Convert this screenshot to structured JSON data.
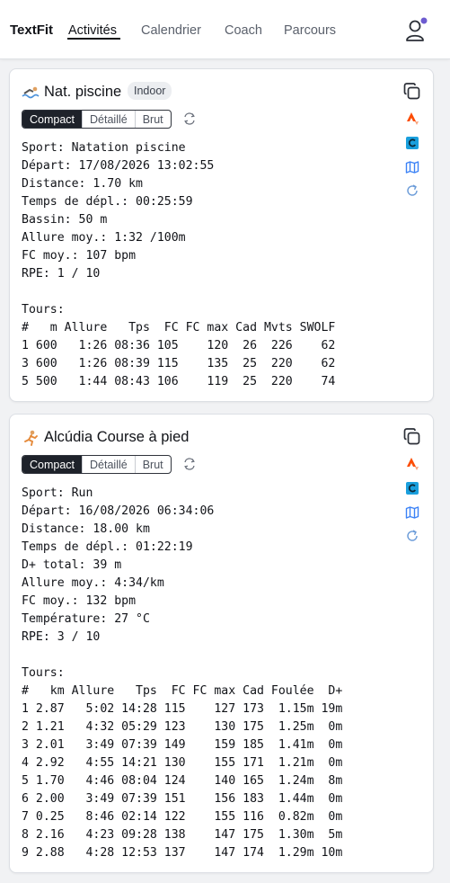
{
  "app": {
    "brand": "TextFit",
    "nav": [
      "Activités",
      "Calendrier",
      "Coach",
      "Parcours"
    ],
    "active_nav": "Activités"
  },
  "colors": {
    "strava": "#fc4c02",
    "garmin": "#1a9fdd",
    "accent_blue": "#3b82f6",
    "notification_dot": "#6d5bd0"
  },
  "view_modes": [
    "Compact",
    "Détaillé",
    "Brut"
  ],
  "activities": [
    {
      "title": "Nat. piscine",
      "badge": "Indoor",
      "selected_mode": "Compact",
      "lines": [
        "Sport: Natation piscine",
        "Départ: 17/08/2026 13:02:55",
        "Distance: 1.70 km",
        "Temps de dépl.: 00:25:59",
        "Bassin: 50 m",
        "Allure moy.: 1:32 /100m",
        "FC moy.: 107 bpm",
        "RPE: 1 / 10",
        "",
        "Tours:",
        "#   m Allure   Tps  FC FC max Cad Mvts SWOLF",
        "1 600   1:26 08:36 105    120  26  226    62",
        "3 600   1:26 08:39 115    135  25  220    62",
        "5 500   1:44 08:43 106    119  25  220    74"
      ]
    },
    {
      "title": "Alcúdia Course à pied",
      "badge": "",
      "selected_mode": "Compact",
      "lines": [
        "Sport: Run",
        "Départ: 16/08/2026 06:34:06",
        "Distance: 18.00 km",
        "Temps de dépl.: 01:22:19",
        "D+ total: 39 m",
        "Allure moy.: 4:34/km",
        "FC moy.: 132 bpm",
        "Température: 27 °C",
        "RPE: 3 / 10",
        "",
        "Tours:",
        "#   km Allure   Tps  FC FC max Cad Foulée  D+",
        "1 2.87   5:02 14:28 115    127 173  1.15m 19m",
        "2 1.21   4:32 05:29 123    130 175  1.25m  0m",
        "3 2.01   3:49 07:39 149    159 185  1.41m  0m",
        "4 2.92   4:55 14:21 130    155 171  1.21m  0m",
        "5 1.70   4:46 08:04 124    140 165  1.24m  8m",
        "6 2.00   3:49 07:39 151    156 183  1.44m  0m",
        "7 0.25   8:46 02:14 122    155 116  0.82m  0m",
        "8 2.16   4:23 09:28 138    147 175  1.30m  5m",
        "9 2.88   4:28 12:53 137    147 174  1.29m 10m"
      ]
    }
  ],
  "icons": {
    "copy": "copy-icon",
    "strava": "strava-icon",
    "garmin": "garmin-connect-icon",
    "map": "map-icon",
    "reload": "reload-icon",
    "sync": "sync-icon",
    "user": "user-icon",
    "swim": "swimmer-icon",
    "run": "runner-icon"
  }
}
